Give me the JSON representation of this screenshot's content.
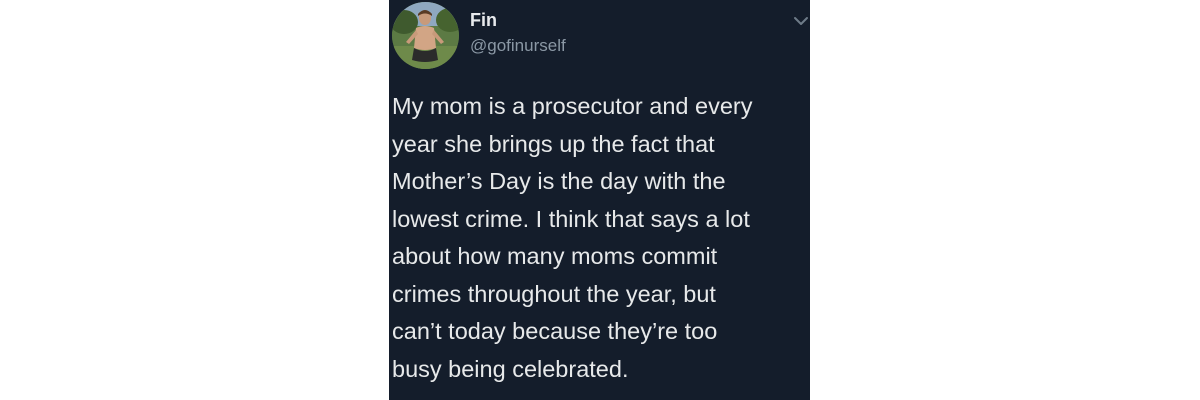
{
  "tweet": {
    "author": {
      "display_name": "Fin",
      "handle": "@gofinurself"
    },
    "body_lines": [
      "My mom is a prosecutor and every",
      "year she brings up the fact that",
      "Mother’s Day is the day with the",
      "lowest crime. I think that says a lot",
      "about how many moms commit",
      "crimes throughout the year, but",
      "can’t today because they’re too",
      "busy being celebrated."
    ]
  },
  "icons": {
    "avatar": "profile-photo",
    "menu": "chevron-down-icon"
  },
  "colors": {
    "background": "#141d2b",
    "primary_text": "#e7e9ea",
    "secondary_text": "#8b98a5"
  }
}
